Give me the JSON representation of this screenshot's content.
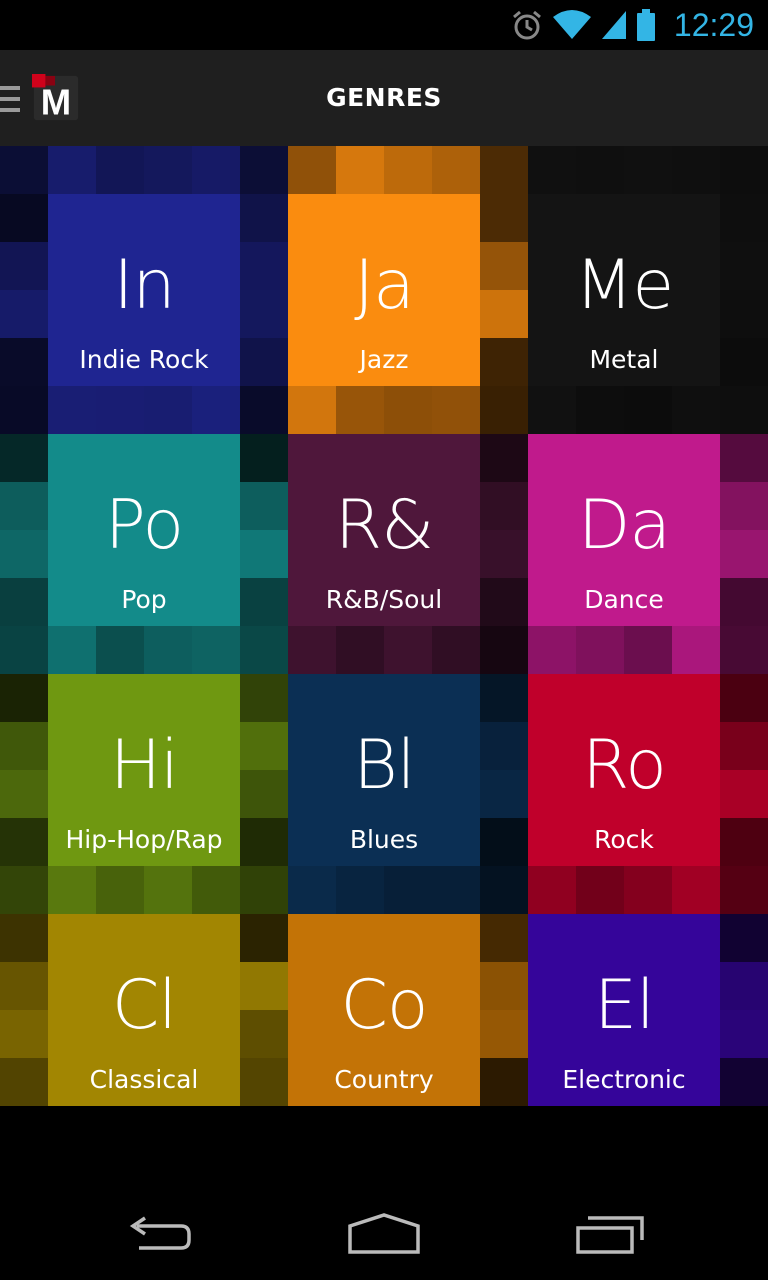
{
  "status_bar": {
    "time": "12:29",
    "icons": [
      "alarm-icon",
      "wifi-icon",
      "signal-icon",
      "battery-icon"
    ],
    "icon_color": "#33b5e5"
  },
  "action_bar": {
    "title": "GENRES",
    "logo_letter": "M",
    "logo_accent": "#d0021b",
    "icons": [
      "menu-icon"
    ]
  },
  "genres": [
    {
      "abbr": "In",
      "name": "Indie Rock",
      "color": "#1f2591"
    },
    {
      "abbr": "Ja",
      "name": "Jazz",
      "color": "#fa8c0f"
    },
    {
      "abbr": "Me",
      "name": "Metal",
      "color": "#141414"
    },
    {
      "abbr": "Po",
      "name": "Pop",
      "color": "#138b8a"
    },
    {
      "abbr": "R&",
      "name": "R&B/Soul",
      "color": "#4f173b"
    },
    {
      "abbr": "Da",
      "name": "Dance",
      "color": "#c01a8c"
    },
    {
      "abbr": "Hi",
      "name": "Hip-Hop/Rap",
      "color": "#6f9811"
    },
    {
      "abbr": "Bl",
      "name": "Blues",
      "color": "#0b2f54"
    },
    {
      "abbr": "Ro",
      "name": "Rock",
      "color": "#c0002b"
    },
    {
      "abbr": "Cl",
      "name": "Classical",
      "color": "#a28602"
    },
    {
      "abbr": "Co",
      "name": "Country",
      "color": "#c37306"
    },
    {
      "abbr": "El",
      "name": "Electronic",
      "color": "#35059a"
    }
  ],
  "nav_bar": {
    "icons": [
      "back-icon",
      "home-icon",
      "recent-apps-icon"
    ]
  }
}
